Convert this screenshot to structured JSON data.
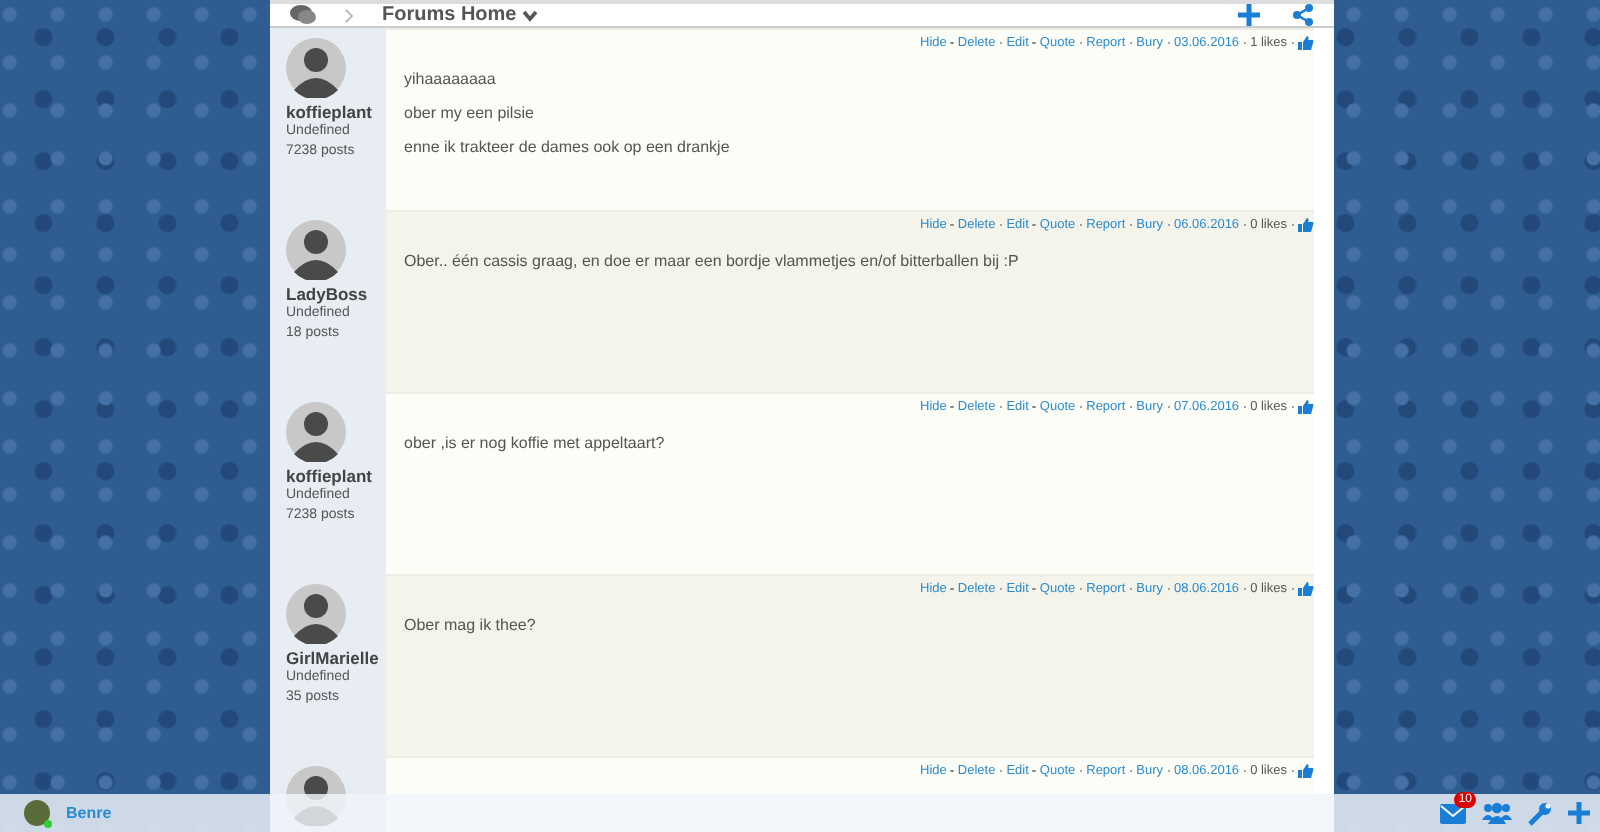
{
  "topbar": {
    "breadcrumb": "Forums Home"
  },
  "posts": [
    {
      "author": "koffieplant",
      "rank": "Undefined",
      "posts": "7238 posts",
      "actions": [
        "Hide",
        "Delete",
        "Edit",
        "Quote",
        "Report",
        "Bury"
      ],
      "date": "03.06.2016",
      "likes": "1 likes",
      "lines": [
        "yihaaaaaaaa",
        "ober my een pilsie",
        "enne ik trakteer de dames ook op een drankje"
      ]
    },
    {
      "author": "LadyBoss",
      "rank": "Undefined",
      "posts": "18 posts",
      "actions": [
        "Hide",
        "Delete",
        "Edit",
        "Quote",
        "Report",
        "Bury"
      ],
      "date": "06.06.2016",
      "likes": "0 likes",
      "lines": [
        "Ober.. één cassis graag, en doe er maar een bordje vlammetjes en/of bitterballen bij :P"
      ]
    },
    {
      "author": "koffieplant",
      "rank": "Undefined",
      "posts": "7238 posts",
      "actions": [
        "Hide",
        "Delete",
        "Edit",
        "Quote",
        "Report",
        "Bury"
      ],
      "date": "07.06.2016",
      "likes": "0 likes",
      "lines": [
        "ober ,is er nog koffie met appeltaart?"
      ]
    },
    {
      "author": "GirlMarielle",
      "rank": "Undefined",
      "posts": "35 posts",
      "actions": [
        "Hide",
        "Delete",
        "Edit",
        "Quote",
        "Report",
        "Bury"
      ],
      "date": "08.06.2016",
      "likes": "0 likes",
      "lines": [
        "Ober mag ik thee?"
      ]
    },
    {
      "actions": [
        "Hide",
        "Delete",
        "Edit",
        "Quote",
        "Report",
        "Bury"
      ],
      "date": "08.06.2016",
      "likes": "0 likes"
    }
  ],
  "bottombar": {
    "user": "Benre",
    "mail_badge": "10"
  }
}
